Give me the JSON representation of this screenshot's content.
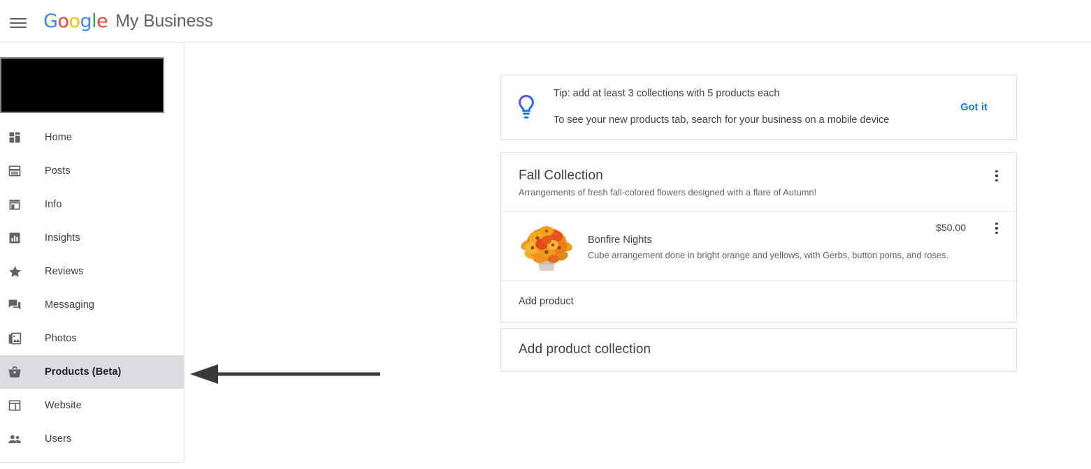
{
  "appbar": {
    "menu_icon": "hamburger-menu-icon",
    "logo_letters": [
      "G",
      "o",
      "o",
      "g",
      "l",
      "e"
    ],
    "product_name": "My Business"
  },
  "sidebar": {
    "business_name_redacted": "",
    "items": [
      {
        "label": "Home",
        "icon": "dashboard-icon",
        "selected": false
      },
      {
        "label": "Posts",
        "icon": "posts-icon",
        "selected": false
      },
      {
        "label": "Info",
        "icon": "storefront-icon",
        "selected": false
      },
      {
        "label": "Insights",
        "icon": "bar-chart-icon",
        "selected": false
      },
      {
        "label": "Reviews",
        "icon": "star-icon",
        "selected": false
      },
      {
        "label": "Messaging",
        "icon": "chat-icon",
        "selected": false
      },
      {
        "label": "Photos",
        "icon": "photo-icon",
        "selected": false
      },
      {
        "label": "Products (Beta)",
        "icon": "basket-icon",
        "selected": true
      },
      {
        "label": "Website",
        "icon": "web-layout-icon",
        "selected": false
      },
      {
        "label": "Users",
        "icon": "people-icon",
        "selected": false
      }
    ]
  },
  "annotation": {
    "type": "left-pointing-arrow",
    "color": "#3a3a3a",
    "points_to": "Products (Beta)"
  },
  "tip_card": {
    "icon": "lightbulb-icon",
    "line1": "Tip: add at least 3 collections with 5 products each",
    "line2": "To see your new products tab, search for your business on a mobile device",
    "dismiss_label": "Got it",
    "dismiss_color": "#1a73e8"
  },
  "collection": {
    "title": "Fall Collection",
    "description": "Arrangements of fresh fall-colored flowers designed with a flare of Autumn!",
    "menu_icon": "more-vert-icon",
    "products": [
      {
        "name": "Bonfire Nights",
        "description": "Cube arrangement done in bright orange and yellows, with Gerbs, button poms, and roses.",
        "price": "$50.00",
        "thumbnail": "orange-flower-bouquet-photo",
        "menu_icon": "more-vert-icon"
      }
    ],
    "add_product_label": "Add product"
  },
  "add_collection": {
    "label": "Add product collection"
  }
}
